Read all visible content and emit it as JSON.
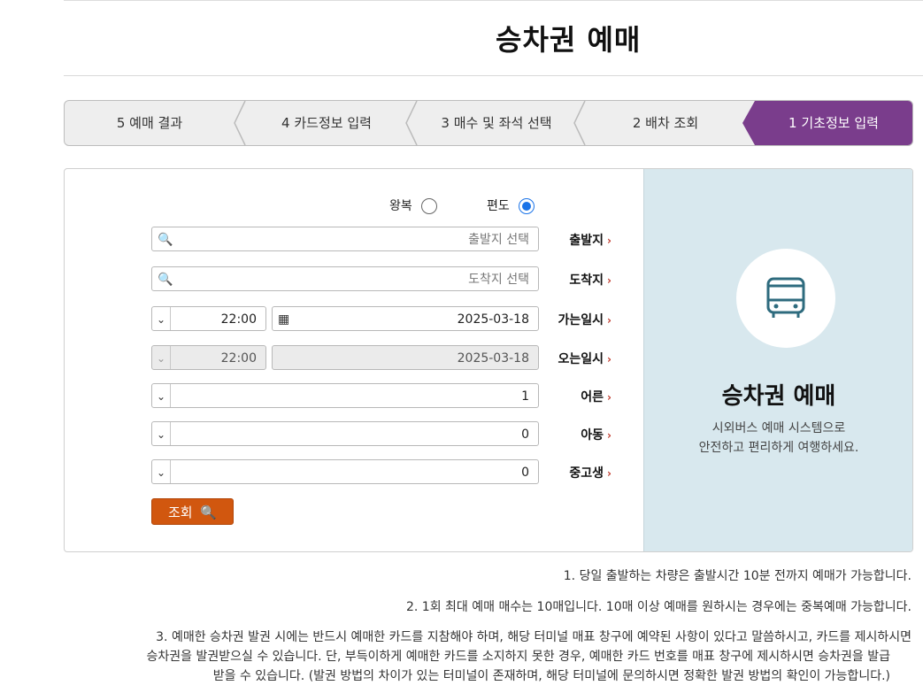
{
  "page": {
    "title": "승차권 예매"
  },
  "steps": [
    {
      "label": "1 기초정보 입력",
      "active": true
    },
    {
      "label": "2 배차 조회",
      "active": false
    },
    {
      "label": "3 매수 및 좌석 선택",
      "active": false
    },
    {
      "label": "4 카드정보 입력",
      "active": false
    },
    {
      "label": "5 예매 결과",
      "active": false
    }
  ],
  "side": {
    "icon": "bus-icon",
    "title": "승차권 예매",
    "desc_line1": "시외버스 예매 시스템으로",
    "desc_line2": "안전하고 편리하게 여행하세요."
  },
  "trip_type": {
    "oneway": "편도",
    "roundtrip": "왕복",
    "selected": "편도"
  },
  "form": {
    "departure": {
      "label": "출발지",
      "placeholder": "출발지 선택"
    },
    "arrival": {
      "label": "도착지",
      "placeholder": "도착지 선택"
    },
    "go_date": {
      "label": "가는일시",
      "date": "2025-03-18",
      "time": "22:00"
    },
    "return_date": {
      "label": "오는일시",
      "date": "2025-03-18",
      "time": "22:00"
    },
    "adult": {
      "label": "어른",
      "value": "1"
    },
    "child": {
      "label": "아동",
      "value": "0"
    },
    "student": {
      "label": "중고생",
      "value": "0"
    }
  },
  "search_button": {
    "label": "조회",
    "color": "#d1570f"
  },
  "notes": [
    "1. 당일 출발하는 차량은 출발시간 10분 전까지 예매가 가능합니다.",
    "2. 1회 최대 예매 매수는 10매입니다. 10매 이상 예매를 원하시는 경우에는 중복예매 가능합니다.",
    "3. 예매한 승차권 발권 시에는 반드시 예매한 카드를 지참해야 하며, 해당 터미널 매표 창구에 예약된 사항이 있다고 말씀하시고, 카드를 제시하시면",
    "승차권을 발권받으실 수 있습니다. 단, 부득이하게 예매한 카드를 소지하지 못한 경우, 예매한 카드 번호를 매표 창구에 제시하시면 승차권을 발급",
    "받을 수 있습니다. (발권 방법의 차이가 있는 터미널이 존재하며, 해당 터미널에 문의하시면 정확한 발권 방법의 확인이 가능합니다.)"
  ],
  "colors": {
    "accent": "#7a3d8c",
    "side_bg": "#d8e8ee",
    "bus_icon": "#2e6b7e"
  }
}
